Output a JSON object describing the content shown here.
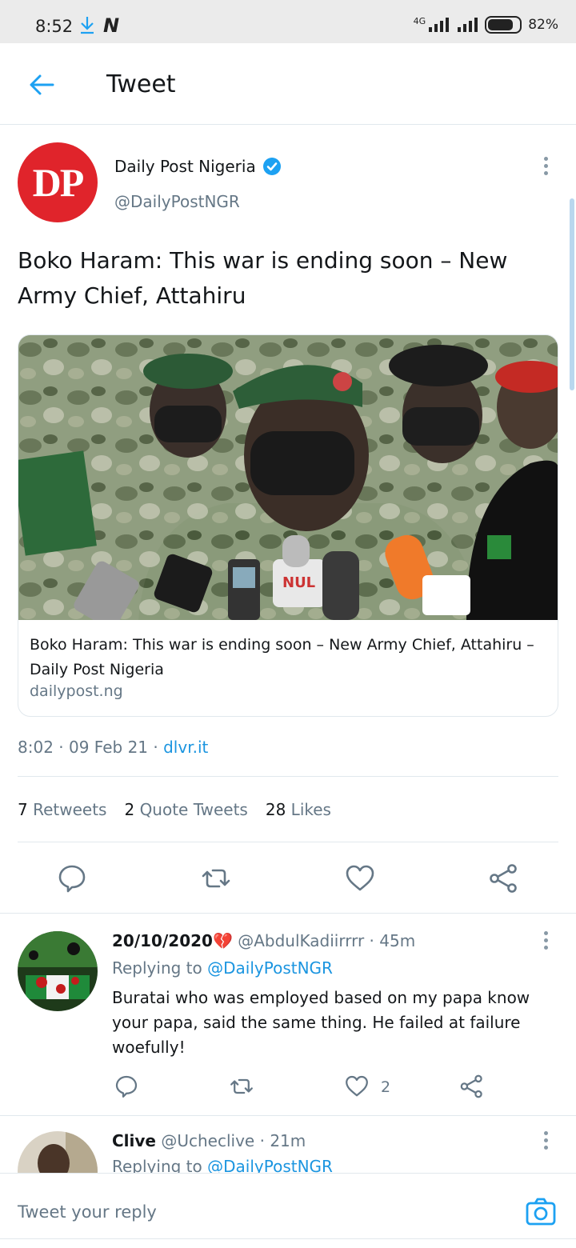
{
  "status_bar": {
    "time": "8:52",
    "network": "4G",
    "battery": "82%",
    "battery_level": 0.82
  },
  "header": {
    "title": "Tweet"
  },
  "tweet": {
    "author": {
      "name": "Daily Post Nigeria",
      "handle": "@DailyPostNGR",
      "avatar_text": "DP"
    },
    "text": "Boko Haram: This war is ending soon – New Army Chief, Attahiru",
    "card": {
      "title": "Boko Haram: This war is ending soon – New Army Chief, Attahiru – Daily Post Nigeria",
      "domain": "dailypost.ng",
      "mic_label": "NUL"
    },
    "time": "8:02",
    "date": "09 Feb 21",
    "source": "dlvr.it",
    "stats": {
      "retweets_count": "7",
      "retweets_label": "Retweets",
      "quotes_count": "2",
      "quotes_label": "Quote Tweets",
      "likes_count": "28",
      "likes_label": "Likes"
    }
  },
  "replies": [
    {
      "name": "20/10/2020💔",
      "handle": "@AbdulKadiirrrr",
      "time": "45m",
      "replying_prefix": "Replying to",
      "replying_to": "@DailyPostNGR",
      "text": "Buratai who was employed based on my papa know your papa, said the same thing. He failed at failure woefully!",
      "likes": "2"
    },
    {
      "name": "Clive",
      "handle": "@Ucheclive",
      "time": "21m",
      "replying_prefix": "Replying to",
      "replying_to": "@DailyPostNGR"
    }
  ],
  "reply_bar": {
    "placeholder": "Tweet your reply"
  },
  "colors": {
    "accent": "#1da1f2",
    "link": "#1b95e0",
    "muted": "#657786",
    "dp_red": "#e0242b"
  }
}
